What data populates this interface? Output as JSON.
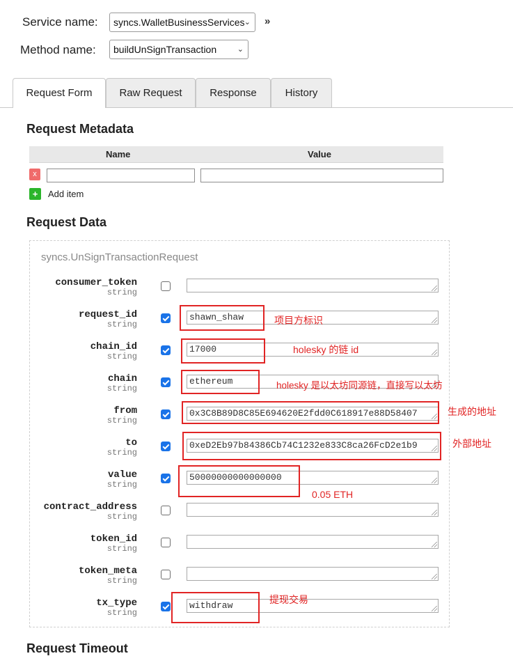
{
  "header": {
    "service_label": "Service name:",
    "service_value": "syncs.WalletBusinessServices",
    "method_label": "Method name:",
    "method_value": "buildUnSignTransaction",
    "expand_icon": "double-chevron-right"
  },
  "tabs": [
    {
      "label": "Request Form",
      "active": true
    },
    {
      "label": "Raw Request",
      "active": false
    },
    {
      "label": "Response",
      "active": false
    },
    {
      "label": "History",
      "active": false
    }
  ],
  "metadata": {
    "title": "Request Metadata",
    "col_name": "Name",
    "col_value": "Value",
    "remove_label": "x",
    "add_icon": "+",
    "add_label": "Add item"
  },
  "request_data": {
    "title": "Request Data",
    "message_name": "syncs.UnSignTransactionRequest",
    "fields": [
      {
        "name": "consumer_token",
        "type": "string",
        "checked": false,
        "value": ""
      },
      {
        "name": "request_id",
        "type": "string",
        "checked": true,
        "value": "shawn_shaw"
      },
      {
        "name": "chain_id",
        "type": "string",
        "checked": true,
        "value": "17000"
      },
      {
        "name": "chain",
        "type": "string",
        "checked": true,
        "value": "ethereum"
      },
      {
        "name": "from",
        "type": "string",
        "checked": true,
        "value": "0x3C8B89D8C85E694620E2fdd0C618917e88D58407"
      },
      {
        "name": "to",
        "type": "string",
        "checked": true,
        "value": "0xeD2Eb97b84386Cb74C1232e833C8ca26FcD2e1b9"
      },
      {
        "name": "value",
        "type": "string",
        "checked": true,
        "value": "50000000000000000"
      },
      {
        "name": "contract_address",
        "type": "string",
        "checked": false,
        "value": ""
      },
      {
        "name": "token_id",
        "type": "string",
        "checked": false,
        "value": ""
      },
      {
        "name": "token_meta",
        "type": "string",
        "checked": false,
        "value": ""
      },
      {
        "name": "tx_type",
        "type": "string",
        "checked": true,
        "value": "withdraw"
      }
    ]
  },
  "annotations": {
    "request_id": "项目方标识",
    "chain_id": "holesky 的链 id",
    "chain": "holesky 是以太坊同源链，直接写以太坊",
    "from": "生成的地址",
    "to": "外部地址",
    "value": "0.05 ETH",
    "tx_type": "提现交易"
  },
  "footer_heading": "Request Timeout",
  "colors": {
    "annotation": "#e12424",
    "checkbox": "#1a73e8"
  }
}
